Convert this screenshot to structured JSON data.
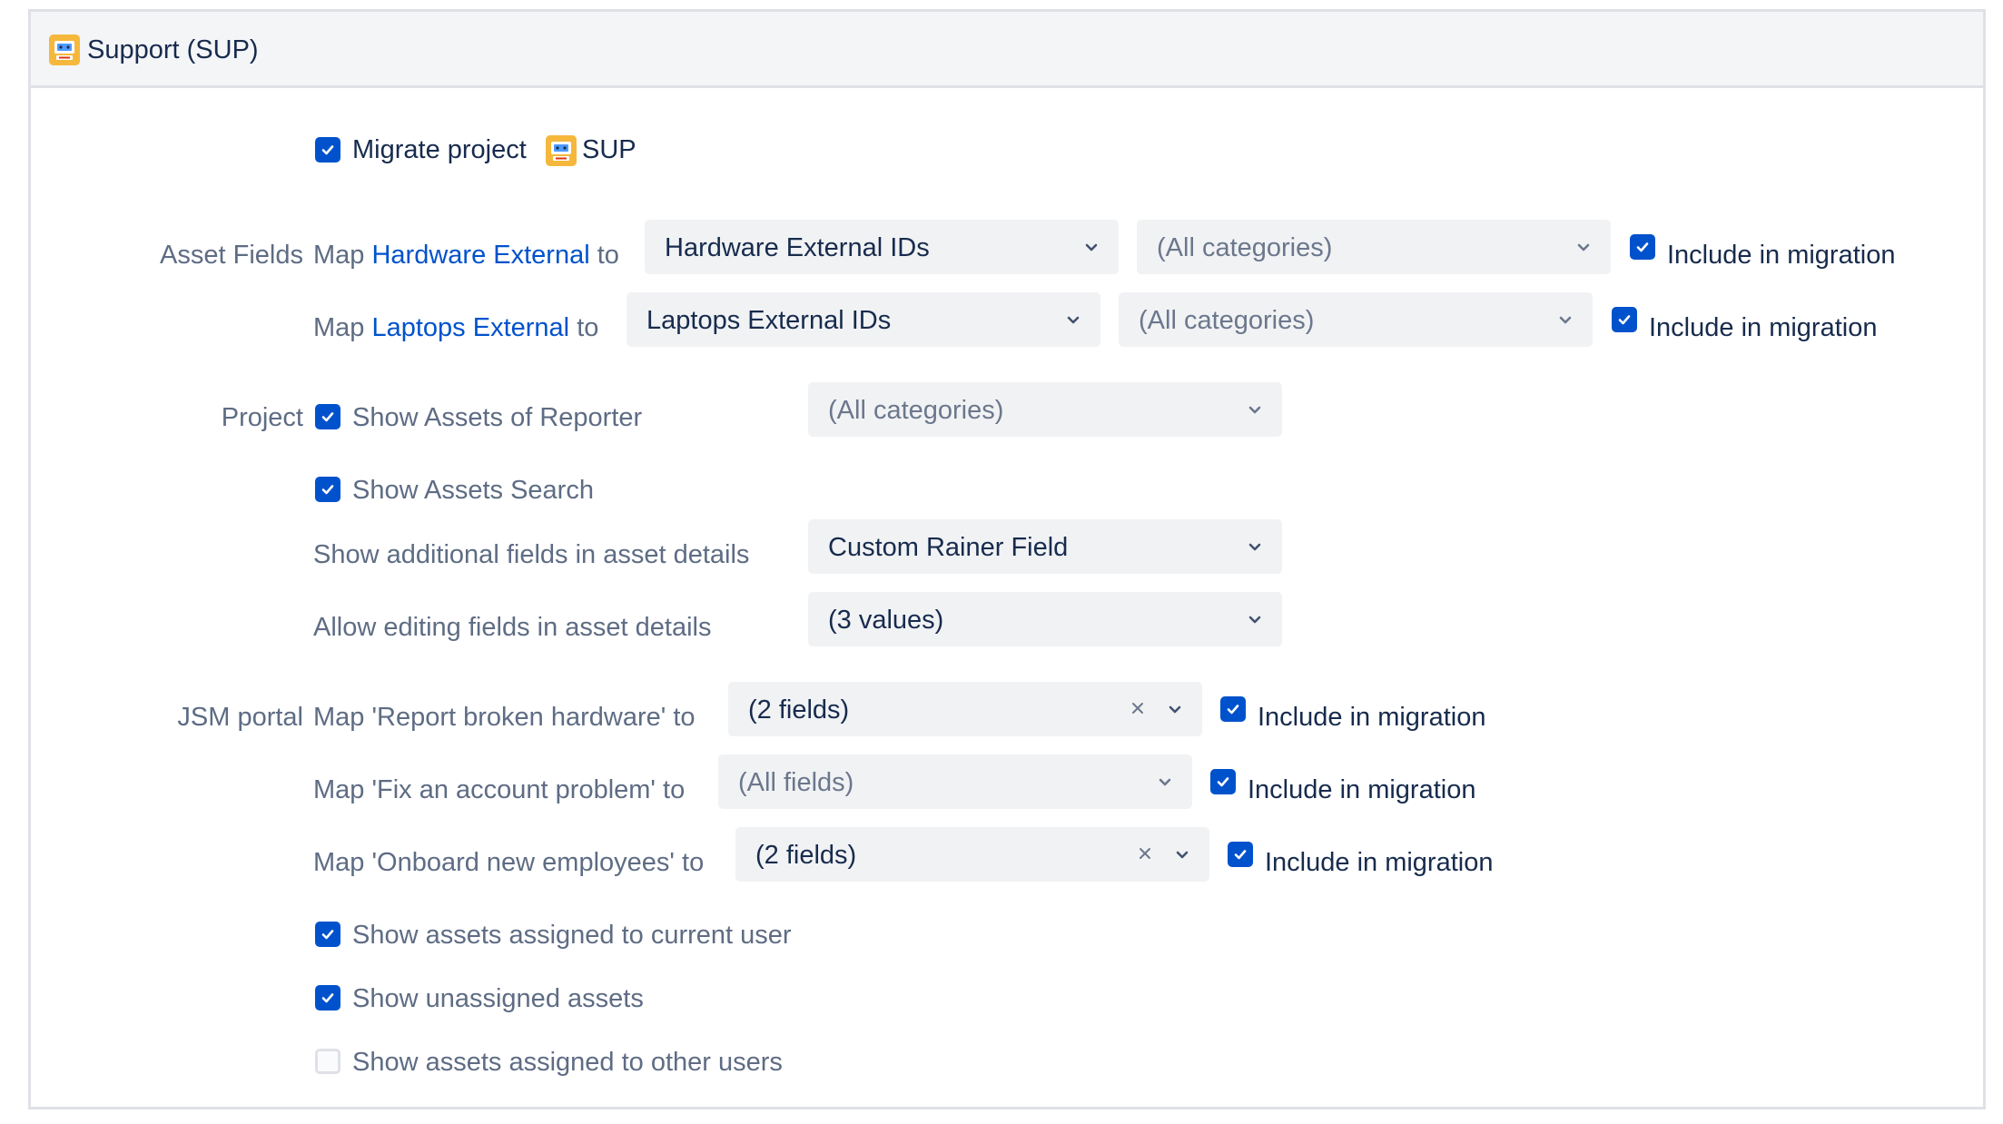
{
  "project": {
    "title": "Support (SUP)",
    "key": "SUP",
    "icon": "project-avatar-icon"
  },
  "migrate": {
    "label": "Migrate project",
    "checked": true
  },
  "asset_fields": {
    "section_label": "Asset Fields",
    "rows": [
      {
        "prefix": "Map ",
        "name": "Hardware External",
        "suffix": " to",
        "object_type": "Hardware External IDs",
        "category": "(All categories)",
        "include_label": "Include in migration",
        "include_checked": true
      },
      {
        "prefix": "Map ",
        "name": "Laptops External",
        "suffix": " to",
        "object_type": "Laptops External IDs",
        "category": "(All categories)",
        "include_label": "Include in migration",
        "include_checked": true
      }
    ]
  },
  "project_section": {
    "section_label": "Project",
    "show_assets_of_reporter": {
      "label": "Show Assets of Reporter",
      "checked": true,
      "category": "(All categories)"
    },
    "show_assets_search": {
      "label": "Show Assets Search",
      "checked": true
    },
    "additional_fields": {
      "label": "Show additional fields in asset details",
      "value": "Custom Rainer Field"
    },
    "editing_fields": {
      "label": "Allow editing fields in asset details",
      "value": "(3 values)"
    }
  },
  "jsm_portal": {
    "section_label": "JSM portal",
    "rows": [
      {
        "label": "Map 'Report broken hardware' to",
        "value": "(2 fields)",
        "clearable": true,
        "include_label": "Include in migration",
        "include_checked": true
      },
      {
        "label": "Map 'Fix an account problem' to",
        "value": "(All fields)",
        "clearable": false,
        "include_label": "Include in migration",
        "include_checked": true
      },
      {
        "label": "Map 'Onboard new employees' to",
        "value": "(2 fields)",
        "clearable": true,
        "include_label": "Include in migration",
        "include_checked": true
      }
    ],
    "options": [
      {
        "label": "Show assets assigned to current user",
        "checked": true
      },
      {
        "label": "Show unassigned assets",
        "checked": true
      },
      {
        "label": "Show assets assigned to other users",
        "checked": false
      }
    ]
  },
  "colors": {
    "accent": "#0052cc",
    "link": "#0052cc",
    "label": "#5e6c84",
    "text": "#172b4d",
    "select_bg": "#f1f2f4",
    "header_bg": "#f4f5f7",
    "border": "#dfe1e6",
    "project_icon": "#f5b83d"
  }
}
